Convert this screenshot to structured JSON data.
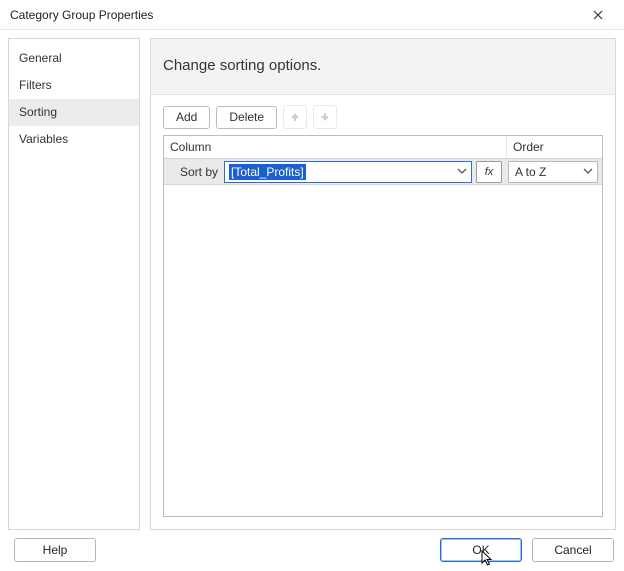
{
  "window": {
    "title": "Category Group Properties"
  },
  "sidebar": {
    "items": [
      {
        "label": "General"
      },
      {
        "label": "Filters"
      },
      {
        "label": "Sorting",
        "selected": true
      },
      {
        "label": "Variables"
      }
    ]
  },
  "main": {
    "heading": "Change sorting options.",
    "toolbar": {
      "add_label": "Add",
      "delete_label": "Delete",
      "move_up_icon": "arrow-up",
      "move_down_icon": "arrow-down"
    },
    "grid": {
      "columns": {
        "column_label": "Column",
        "order_label": "Order"
      },
      "rows": [
        {
          "label": "Sort by",
          "value": "[Total_Profits]",
          "order": "A to Z",
          "fx_label": "fx"
        }
      ]
    }
  },
  "footer": {
    "help_label": "Help",
    "ok_label": "OK",
    "cancel_label": "Cancel"
  }
}
